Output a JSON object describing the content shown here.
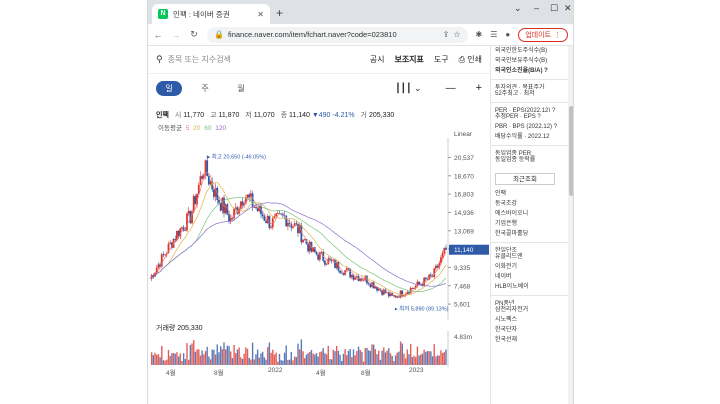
{
  "browser": {
    "tab_title": "인팩 : 네이버 증권",
    "new_tab": "+",
    "url": "finance.naver.com/item/fchart.naver?code=023810",
    "update_label": "업데이트"
  },
  "toolbar": {
    "search_placeholder": "종목 또는 지수검색",
    "disclosure": "공시",
    "indicators": "보조지표",
    "tools": "도구",
    "print": "인쇄"
  },
  "periods": [
    "일",
    "주",
    "월"
  ],
  "ohlc": {
    "name": "인팩",
    "open_label": "시",
    "open": "11,770",
    "high_label": "고",
    "high": "11,870",
    "low_label": "저",
    "low": "11,070",
    "close_label": "종",
    "close": "11,140",
    "change": "▼490",
    "change_pct": "-4.21%",
    "volume_label": "거",
    "volume": "205,330"
  },
  "moving_avg": {
    "label": "이동평균",
    "periods": [
      "5",
      "20",
      "60",
      "120"
    ]
  },
  "scale_label": "Linear",
  "annotations": {
    "max": "최고 20,650 (-46.05%)",
    "min": "최저 5,890 (89.13%)"
  },
  "current_price_tag": "11,140",
  "volume_title": "거래량 205,330",
  "volume_max_label": "4.83m",
  "colors": {
    "up": "#e0342a",
    "down": "#2e5aa8",
    "ma5": "#e77f7f",
    "ma20": "#e0b14a",
    "ma60": "#7bc27b",
    "ma120": "#8a6fd0"
  },
  "chart_data": {
    "type": "line",
    "x": [
      "2021-04",
      "2021-05",
      "2021-06",
      "2021-07",
      "2021-08",
      "2021-09",
      "2021-10",
      "2021-11",
      "2021-12",
      "2022-01",
      "2022-02",
      "2022-03",
      "2022-04",
      "2022-05",
      "2022-06",
      "2022-07",
      "2022-08",
      "2022-09",
      "2022-10",
      "2022-11",
      "2022-12",
      "2023-01",
      "2023-02"
    ],
    "x_tick_labels": [
      "4월",
      "8월",
      "2022",
      "4월",
      "8월",
      "2023"
    ],
    "series": [
      {
        "name": "종",
        "values": [
          8200,
          10500,
          12800,
          14500,
          19500,
          16500,
          14200,
          16800,
          15200,
          13800,
          14500,
          13200,
          11000,
          10200,
          9400,
          8600,
          8200,
          7200,
          6300,
          6900,
          7600,
          8400,
          11140
        ]
      }
    ],
    "y_ticks": [
      20537,
      18670,
      16803,
      14936,
      13069,
      11202,
      9335,
      7468,
      5601
    ],
    "ylim": [
      5000,
      21500
    ],
    "grid": false
  }
}
